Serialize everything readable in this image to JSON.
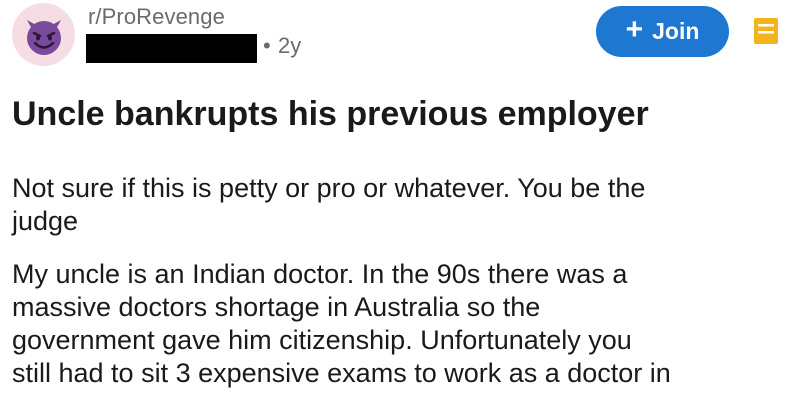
{
  "header": {
    "subreddit": "r/ProRevenge",
    "dot": "•",
    "age": "2y"
  },
  "avatar": {
    "icon": "smiling-devil-icon",
    "color": "#7a4a9c",
    "background": "#f6dde4"
  },
  "actions": {
    "join_label": "Join",
    "join_plus": "+",
    "join_color": "#1e78d2",
    "save_icon": "save-icon",
    "save_color": "#f2b31b"
  },
  "post": {
    "title": "Uncle bankrupts his previous employer",
    "paragraphs": [
      {
        "lines": [
          "Not sure if this is petty or pro or whatever. You be the",
          "judge"
        ]
      },
      {
        "lines": [
          "My uncle is an Indian doctor. In the 90s there was a",
          "massive doctors shortage in Australia so the",
          "government gave him citizenship. Unfortunately you",
          "still had to sit 3 expensive exams to work as a doctor in"
        ]
      }
    ]
  }
}
